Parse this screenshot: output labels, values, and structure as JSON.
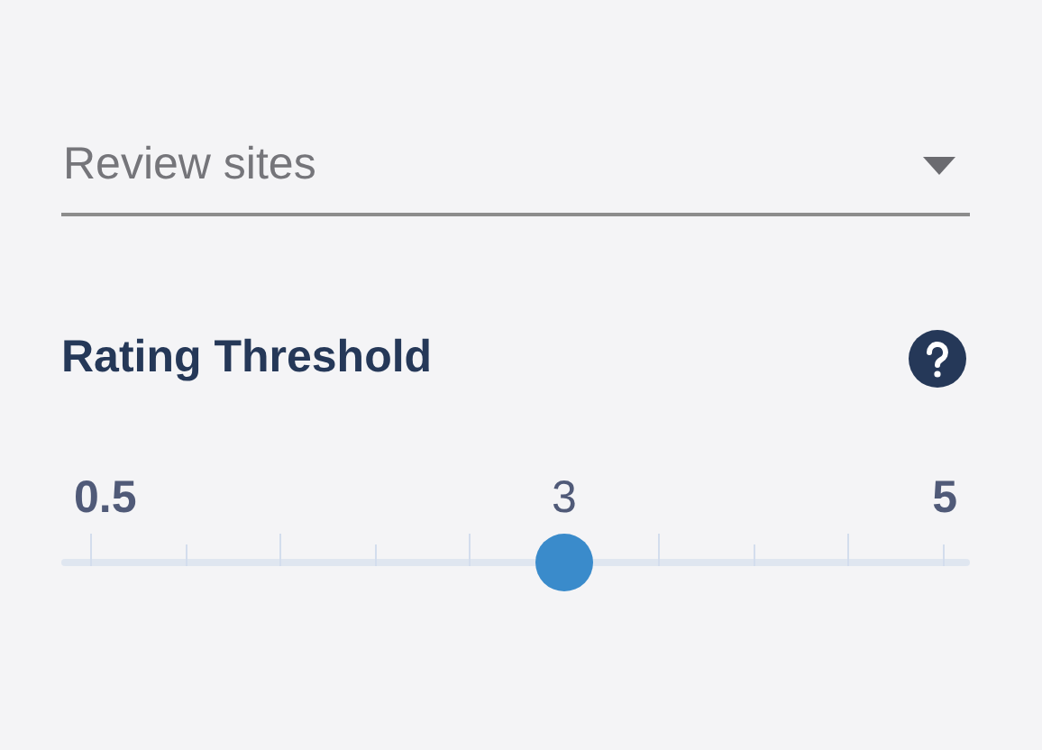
{
  "dropdown": {
    "placeholder": "Review sites"
  },
  "rating_threshold": {
    "title": "Rating Threshold",
    "min_label": "0.5",
    "value_label": "3",
    "max_label": "5",
    "level": 0.556
  }
}
